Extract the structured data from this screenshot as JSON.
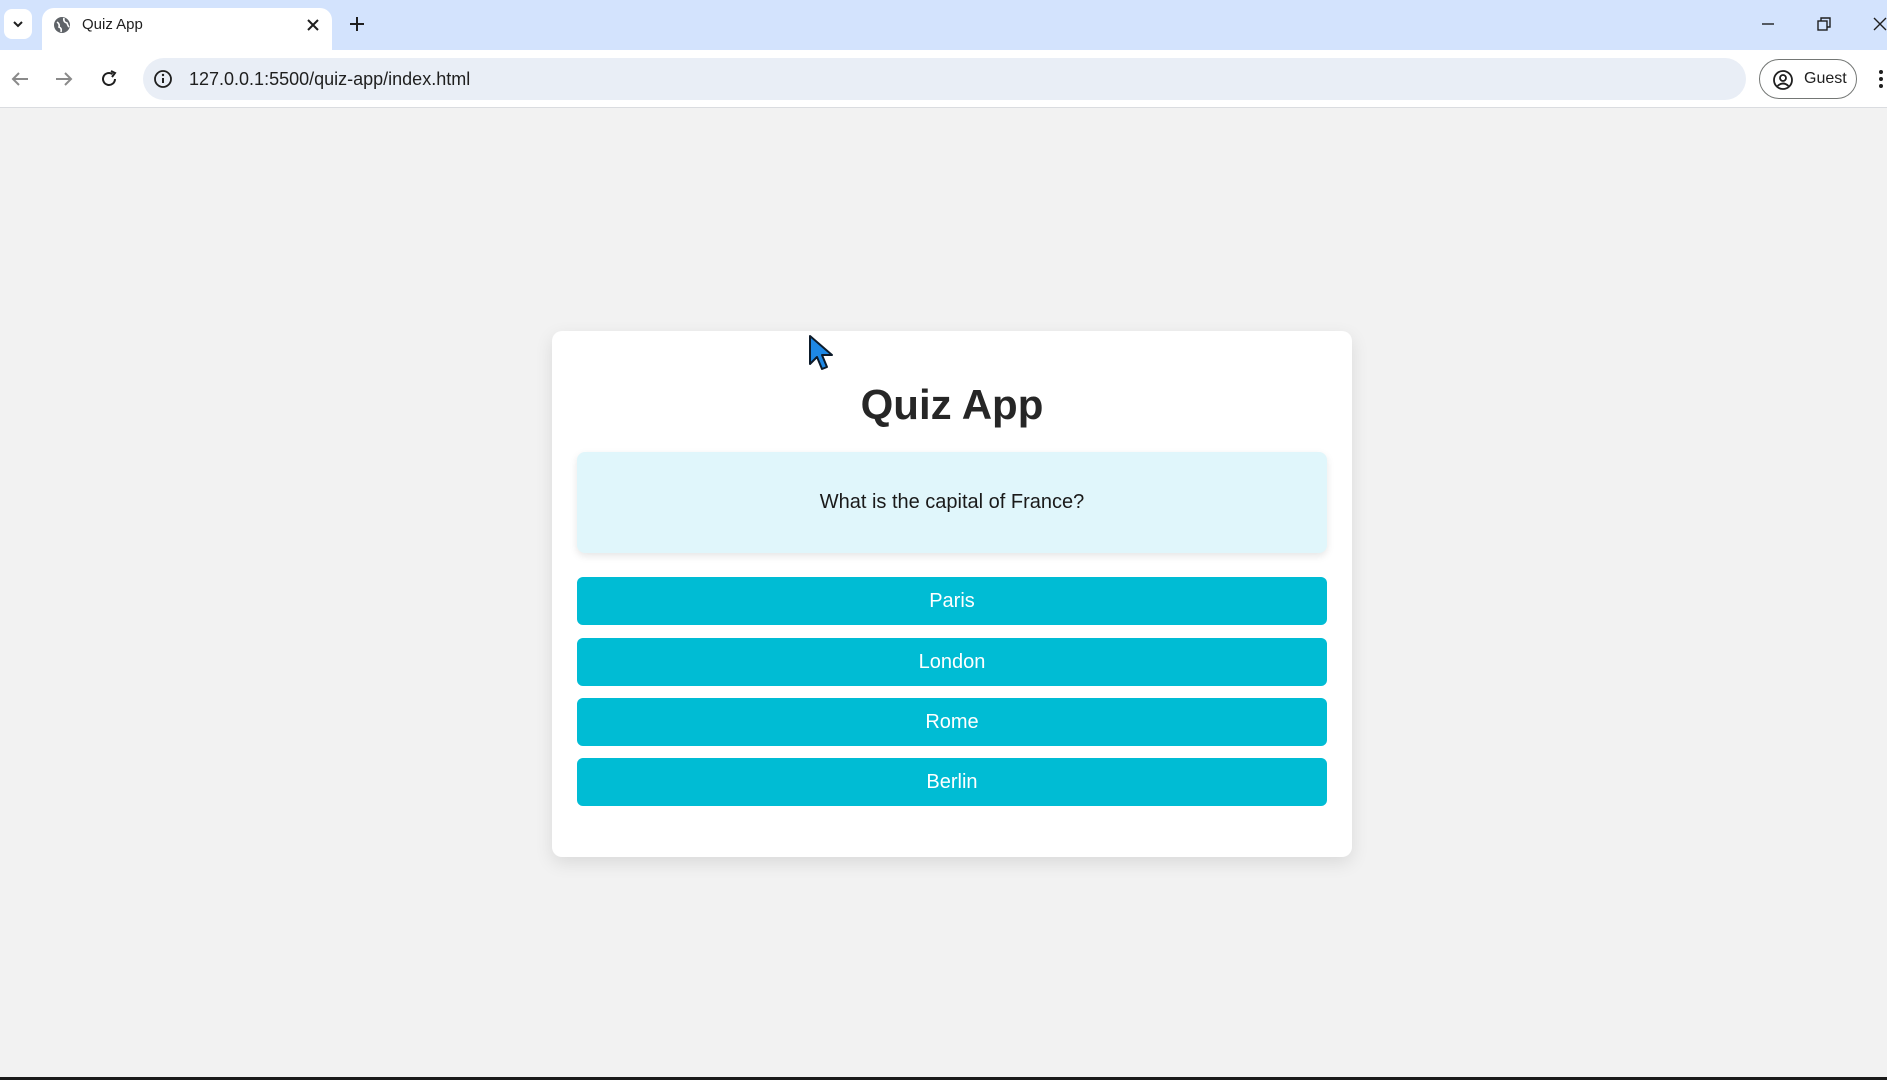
{
  "browser": {
    "tab_title": "Quiz App",
    "url": "127.0.0.1:5500/quiz-app/index.html",
    "profile_label": "Guest"
  },
  "quiz": {
    "title": "Quiz App",
    "question": "What is the capital of France?",
    "answers": [
      "Paris",
      "London",
      "Rome",
      "Berlin"
    ]
  },
  "colors": {
    "answer_button": "#00bcd4",
    "question_bg": "#e0f6fb",
    "page_bg": "#f2f2f2"
  }
}
